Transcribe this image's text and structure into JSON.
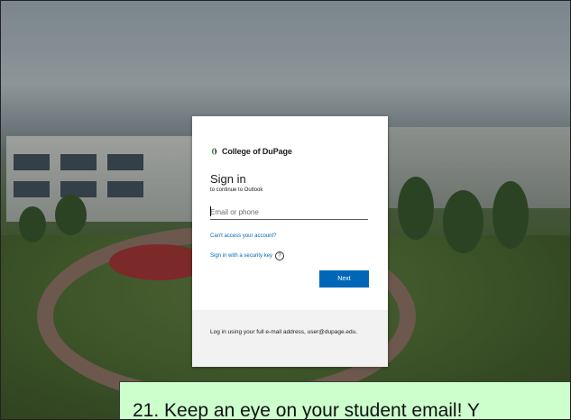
{
  "login": {
    "org_name": "College of DuPage",
    "title": "Sign in",
    "subtitle": "to continue to Outlook",
    "email_placeholder": "Email or phone",
    "cant_access_link": "Can't access your account?",
    "security_key_link": "Sign in with a security key",
    "help_glyph": "?",
    "next_button": "Next",
    "footer_text": "Log in using your full e-mail address, user@dupage.edu."
  },
  "caption": {
    "text": "21. Keep an eye on your student email! Y"
  },
  "colors": {
    "accent": "#0067b8",
    "caption_bg": "#ccffcc",
    "footer_bg": "#f2f2f2"
  },
  "icons": {
    "logo": "college-of-dupage-leaf-logo",
    "help": "question-circle-icon"
  }
}
